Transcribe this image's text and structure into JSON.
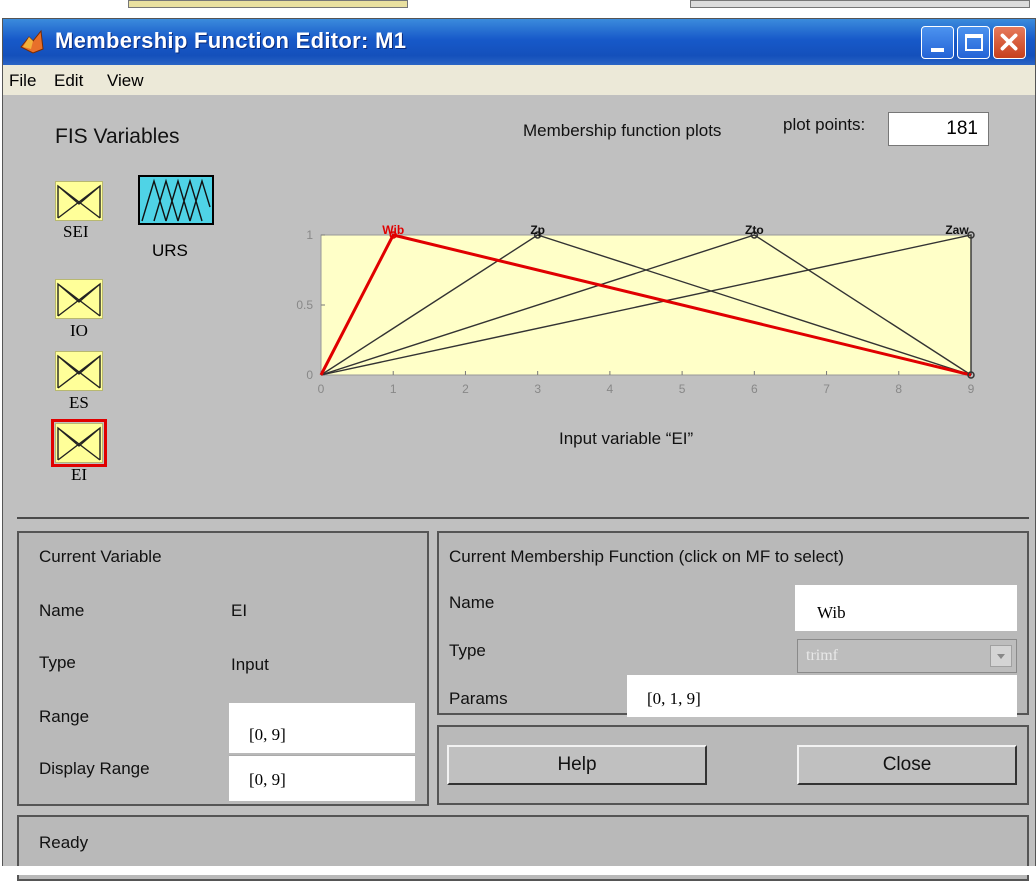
{
  "window": {
    "title": "Membership Function Editor: M1"
  },
  "menu": [
    "File",
    "Edit",
    "View"
  ],
  "fis": {
    "title": "FIS Variables",
    "variables": [
      {
        "label": "SEI",
        "kind": "input"
      },
      {
        "label": "URS",
        "kind": "output"
      },
      {
        "label": "IO",
        "kind": "input"
      },
      {
        "label": "ES",
        "kind": "input"
      },
      {
        "label": "EI",
        "kind": "input",
        "selected": true
      }
    ]
  },
  "plot": {
    "header": "Membership function plots",
    "plot_points_label": "plot points:",
    "plot_points": "181",
    "xlabel": "Input variable “EI”"
  },
  "chart_data": {
    "type": "line",
    "xlim": [
      0,
      9
    ],
    "ylim": [
      0,
      1
    ],
    "xticks": [
      "0",
      "1",
      "2",
      "3",
      "4",
      "5",
      "6",
      "7",
      "8",
      "9"
    ],
    "yticks": [
      "0",
      "0.5",
      "1"
    ],
    "background": "#ffffc8",
    "series": [
      {
        "name": "Wib",
        "x": [
          0,
          1,
          9
        ],
        "y": [
          0,
          1,
          0
        ],
        "color": "#e00000",
        "selected": true
      },
      {
        "name": "Zp",
        "x": [
          0,
          3,
          9
        ],
        "y": [
          0,
          1,
          0
        ],
        "color": "#333333"
      },
      {
        "name": "Zto",
        "x": [
          0,
          6,
          9
        ],
        "y": [
          0,
          1,
          0
        ],
        "color": "#333333"
      },
      {
        "name": "Zaw",
        "x": [
          0,
          9,
          9
        ],
        "y": [
          0,
          1,
          0
        ],
        "color": "#333333"
      }
    ]
  },
  "current_variable": {
    "title": "Current Variable",
    "name_label": "Name",
    "name_value": "EI",
    "type_label": "Type",
    "type_value": "Input",
    "range_label": "Range",
    "range_value": "[0, 9]",
    "display_range_label": "Display Range",
    "display_range_value": "[0, 9]"
  },
  "current_mf": {
    "title": "Current Membership Function (click on MF to select)",
    "name_label": "Name",
    "name_value": "Wib",
    "type_label": "Type",
    "type_value": "trimf",
    "params_label": "Params",
    "params_value": "[0, 1, 9]"
  },
  "buttons": {
    "help": "Help",
    "close": "Close"
  },
  "status": "Ready"
}
